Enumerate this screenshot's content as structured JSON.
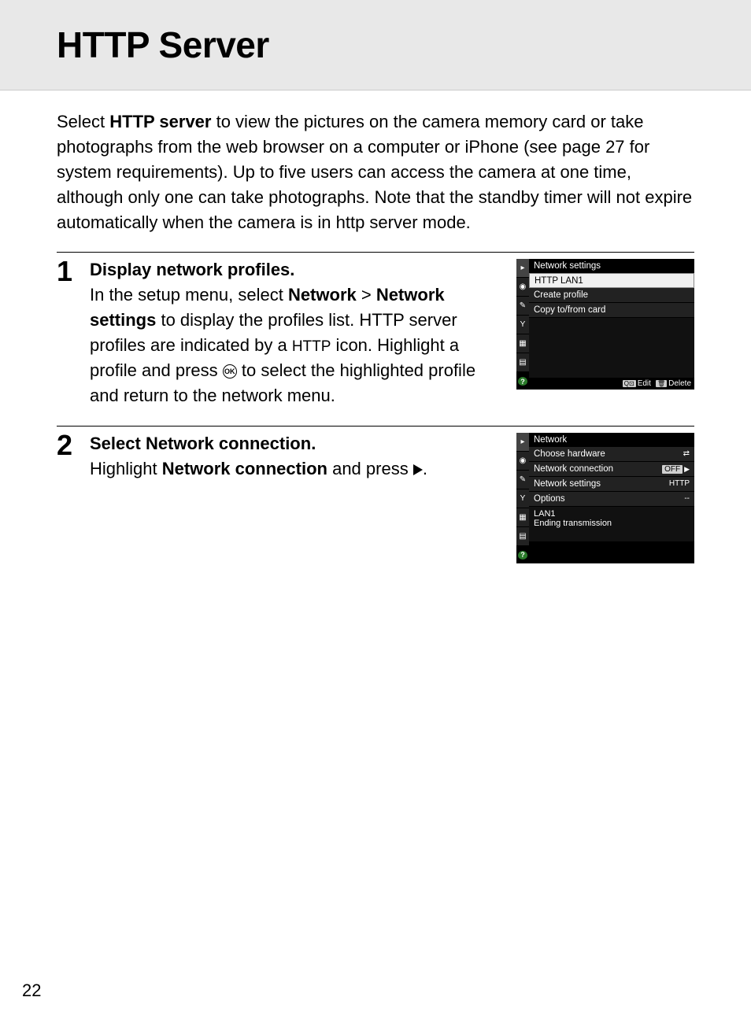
{
  "title": "HTTP Server",
  "intro": {
    "pre": "Select ",
    "bold": "HTTP server",
    "post": " to view the pictures on the camera memory card or take photographs from the web browser on a computer or iPhone (see page 27 for system requirements). Up to five users can access the camera at one time, although only one can take photographs. Note that the standby timer will not expire automatically when the camera is in http server mode."
  },
  "steps": [
    {
      "num": "1",
      "heading": "Display network profiles.",
      "body_parts": {
        "a": "In the setup menu, select ",
        "b": "Network",
        "c": " > ",
        "d": "Network settings",
        "e": " to display the profiles list. HTTP server profiles are indicated by a ",
        "f": "HTTP",
        "g": " icon. Highlight a profile and press ",
        "h": " to select the highlighted profile and return to the network menu."
      },
      "screenshot": {
        "title": "Network settings",
        "rows": [
          {
            "label": "HTTP LAN1",
            "selected": true
          },
          {
            "label": "Create profile"
          },
          {
            "label": "Copy to/from card"
          }
        ],
        "footer": {
          "edit": "Edit",
          "delete": "Delete"
        }
      }
    },
    {
      "num": "2",
      "heading_pre": "Select ",
      "heading_bold": "Network connection",
      "heading_post": ".",
      "body_parts": {
        "a": "Highlight ",
        "b": "Network connection",
        "c": " and press ",
        "d": "."
      },
      "screenshot": {
        "title": "Network",
        "rows": [
          {
            "label": "Choose hardware",
            "value_icon": "net"
          },
          {
            "label": "Network connection",
            "value": "OFF",
            "value_box": true,
            "arrow": true
          },
          {
            "label": "Network settings",
            "value": "HTTP"
          },
          {
            "label": "Options",
            "value": "--"
          }
        ],
        "status": {
          "line1": "LAN1",
          "line2": "Ending transmission"
        }
      }
    }
  ],
  "page_number": "22",
  "icons": {
    "ok": "OK"
  },
  "sidebar_icons": [
    "▸",
    "◉",
    "✎",
    "Y",
    "▦",
    "▤",
    "?"
  ]
}
